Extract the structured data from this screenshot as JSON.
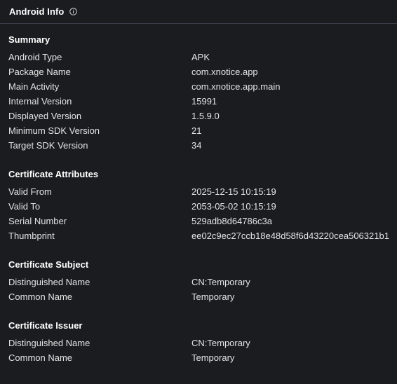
{
  "header": {
    "title": "Android Info",
    "info_icon": "info-circle-icon"
  },
  "sections": [
    {
      "title": "Summary",
      "rows": [
        {
          "label": "Android Type",
          "value": "APK"
        },
        {
          "label": "Package Name",
          "value": "com.xnotice.app"
        },
        {
          "label": "Main Activity",
          "value": "com.xnotice.app.main"
        },
        {
          "label": "Internal Version",
          "value": "15991"
        },
        {
          "label": "Displayed Version",
          "value": "1.5.9.0"
        },
        {
          "label": "Minimum SDK Version",
          "value": "21"
        },
        {
          "label": "Target SDK Version",
          "value": "34"
        }
      ]
    },
    {
      "title": "Certificate Attributes",
      "rows": [
        {
          "label": "Valid From",
          "value": "2025-12-15 10:15:19"
        },
        {
          "label": "Valid To",
          "value": "2053-05-02 10:15:19"
        },
        {
          "label": "Serial Number",
          "value": "529adb8d64786c3a"
        },
        {
          "label": "Thumbprint",
          "value": "ee02c9ec27ccb18e48d58f6d43220cea506321b1"
        }
      ]
    },
    {
      "title": "Certificate Subject",
      "rows": [
        {
          "label": "Distinguished Name",
          "value": "CN:Temporary"
        },
        {
          "label": "Common Name",
          "value": "Temporary"
        }
      ]
    },
    {
      "title": "Certificate Issuer",
      "rows": [
        {
          "label": "Distinguished Name",
          "value": "CN:Temporary"
        },
        {
          "label": "Common Name",
          "value": "Temporary"
        }
      ]
    }
  ]
}
